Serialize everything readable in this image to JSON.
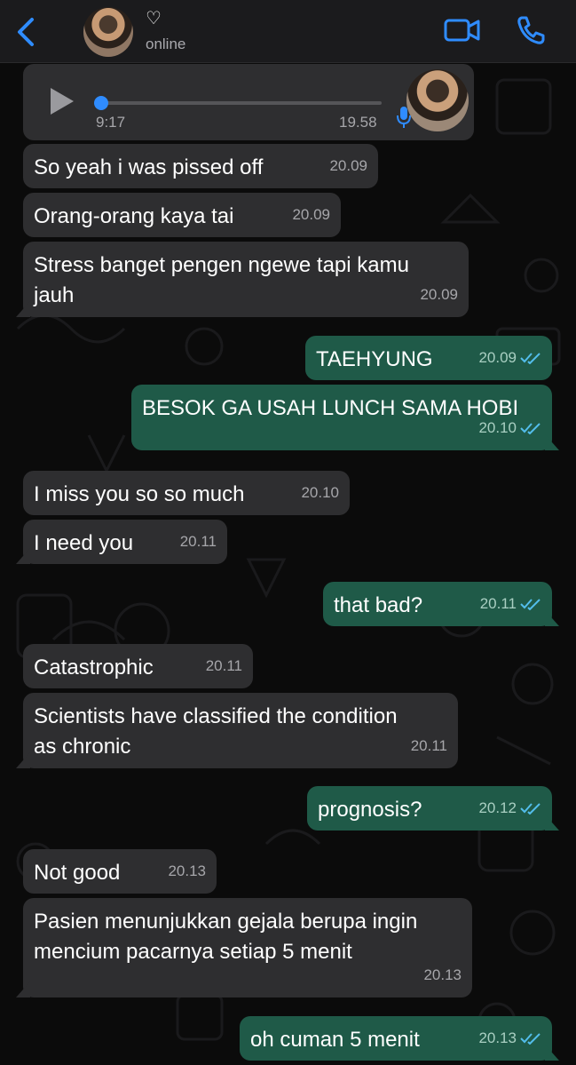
{
  "header": {
    "contact_name": "♡",
    "status": "online"
  },
  "voice_note": {
    "duration": "9:17",
    "time": "19.58"
  },
  "messages": [
    {
      "dir": "in",
      "text": "So yeah i was pissed off",
      "time": "20.09"
    },
    {
      "dir": "in",
      "text": "Orang-orang kaya tai",
      "time": "20.09"
    },
    {
      "dir": "in",
      "text": "Stress banget pengen ngewe tapi kamu jauh",
      "time": "20.09"
    },
    {
      "dir": "out",
      "text": "TAEHYUNG",
      "time": "20.09"
    },
    {
      "dir": "out",
      "text": "BESOK GA USAH LUNCH SAMA HOBI",
      "time": "20.10"
    },
    {
      "dir": "in",
      "text": "I miss you so so much",
      "time": "20.10"
    },
    {
      "dir": "in",
      "text": "I need you",
      "time": "20.11"
    },
    {
      "dir": "out",
      "text": "that bad?",
      "time": "20.11"
    },
    {
      "dir": "in",
      "text": "Catastrophic",
      "time": "20.11"
    },
    {
      "dir": "in",
      "text": "Scientists have classified the condition as chronic",
      "time": "20.11"
    },
    {
      "dir": "out",
      "text": "prognosis?",
      "time": "20.12"
    },
    {
      "dir": "in",
      "text": "Not good",
      "time": "20.13"
    },
    {
      "dir": "in",
      "text": "Pasien menunjukkan gejala berupa ingin mencium pacarnya setiap 5 menit",
      "time": "20.13"
    },
    {
      "dir": "out",
      "text": "oh cuman 5 menit",
      "time": "20.13"
    }
  ],
  "colors": {
    "incoming_bubble": "#2e2e30",
    "outgoing_bubble": "#1f5a48",
    "accent": "#2f8cff",
    "read_ticks": "#53bdeb"
  },
  "icons": {
    "back": "chevron-left-icon",
    "video": "video-camera-icon",
    "call": "phone-icon",
    "play": "play-icon",
    "mic": "microphone-icon",
    "read": "double-check-icon"
  }
}
